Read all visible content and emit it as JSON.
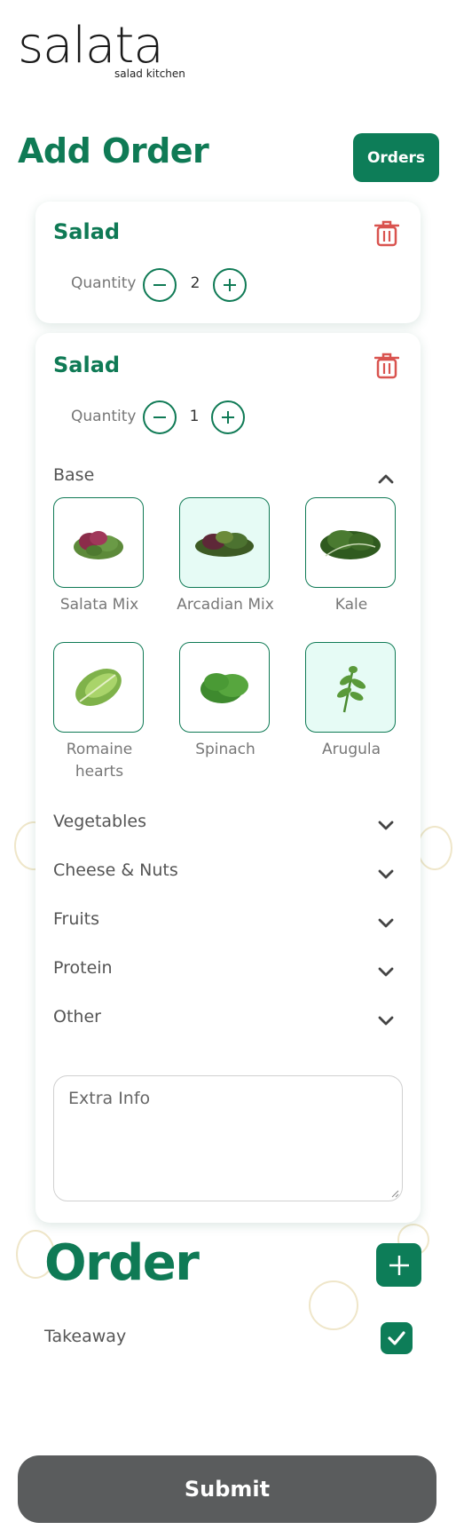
{
  "logo": {
    "wordmark": "salata",
    "tagline": "salad kitchen"
  },
  "header": {
    "title": "Add Order",
    "orders_button": "Orders"
  },
  "items": [
    {
      "title": "Salad",
      "quantity_label": "Quantity",
      "quantity": "2"
    },
    {
      "title": "Salad",
      "quantity_label": "Quantity",
      "quantity": "1",
      "base_section": {
        "label": "Base",
        "options": [
          {
            "label": "Salata Mix",
            "selected": false
          },
          {
            "label": "Arcadian Mix",
            "selected": true
          },
          {
            "label": "Kale",
            "selected": false
          },
          {
            "label": "Romaine hearts",
            "selected": false
          },
          {
            "label": "Spinach",
            "selected": false
          },
          {
            "label": "Arugula",
            "selected": true
          }
        ]
      },
      "collapsed_sections": [
        "Vegetables",
        "Cheese & Nuts",
        "Fruits",
        "Protein",
        "Other"
      ],
      "extra_info_placeholder": "Extra Info"
    }
  ],
  "order": {
    "title": "Order",
    "takeaway_label": "Takeaway",
    "takeaway_checked": true,
    "submit_label": "Submit"
  },
  "colors": {
    "accent": "#0d7d58",
    "trash": "#d9534f",
    "submit_bg": "#5a5c5d",
    "selected_tile": "#e6fbf5"
  }
}
